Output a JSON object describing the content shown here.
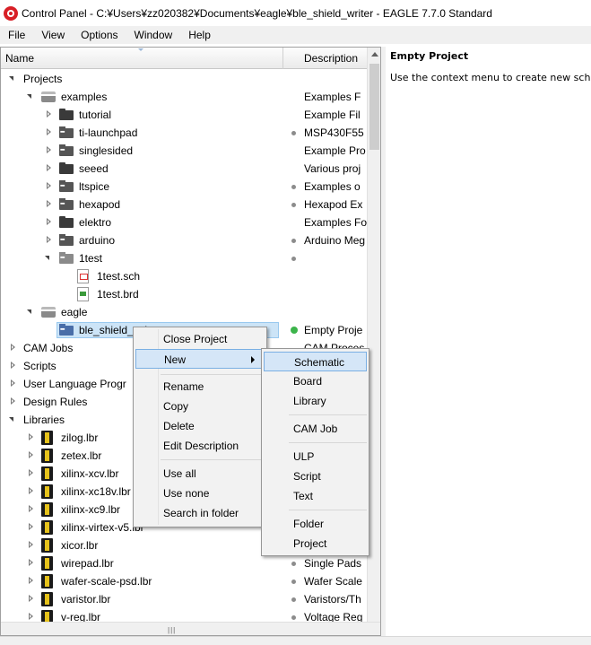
{
  "window": {
    "title": "Control Panel - C:¥Users¥zz020382¥Documents¥eagle¥ble_shield_writer - EAGLE 7.7.0 Standard"
  },
  "menubar": {
    "items": [
      {
        "label": "File"
      },
      {
        "label": "View"
      },
      {
        "label": "Options"
      },
      {
        "label": "Window"
      },
      {
        "label": "Help"
      }
    ]
  },
  "tree": {
    "header": {
      "name": "Name",
      "description": "Description"
    },
    "rows": [
      {
        "label": "Projects",
        "desc": "",
        "icon": "none",
        "toggle": "expanded",
        "dot": ""
      },
      {
        "label": "examples",
        "desc": "Examples F",
        "icon": "projects-folder-icon",
        "toggle": "expanded",
        "dot": ""
      },
      {
        "label": "tutorial",
        "desc": "Example Fil",
        "icon": "folder-icon",
        "toggle": "collapsed",
        "dot": ""
      },
      {
        "label": "ti-launchpad",
        "desc": "MSP430F55",
        "icon": "project-icon",
        "toggle": "collapsed",
        "dot": "gray"
      },
      {
        "label": "singlesided",
        "desc": "Example Pro",
        "icon": "project-icon",
        "toggle": "collapsed",
        "dot": ""
      },
      {
        "label": "seeed",
        "desc": "Various proj",
        "icon": "folder-icon",
        "toggle": "collapsed",
        "dot": ""
      },
      {
        "label": "ltspice",
        "desc": "Examples o",
        "icon": "project-icon",
        "toggle": "collapsed",
        "dot": "gray"
      },
      {
        "label": "hexapod",
        "desc": "Hexapod Ex",
        "icon": "project-icon",
        "toggle": "collapsed",
        "dot": "gray"
      },
      {
        "label": "elektro",
        "desc": "Examples Fo",
        "icon": "folder-icon",
        "toggle": "collapsed",
        "dot": ""
      },
      {
        "label": "arduino",
        "desc": "Arduino Meg",
        "icon": "project-icon",
        "toggle": "collapsed",
        "dot": "gray"
      },
      {
        "label": "1test",
        "desc": "",
        "icon": "project-icon-light",
        "toggle": "expanded",
        "dot": "gray"
      },
      {
        "label": "1test.sch",
        "desc": "",
        "icon": "schematic-file-icon",
        "toggle": "none",
        "dot": ""
      },
      {
        "label": "1test.brd",
        "desc": "",
        "icon": "board-file-icon",
        "toggle": "none",
        "dot": ""
      },
      {
        "label": "eagle",
        "desc": "",
        "icon": "projects-folder-icon",
        "toggle": "expanded",
        "dot": ""
      },
      {
        "label": "ble_shield_writer",
        "desc": "Empty Proje",
        "icon": "project-icon-blue",
        "toggle": "none",
        "dot": "green"
      },
      {
        "label": "CAM Jobs",
        "desc": "CAM Proces",
        "icon": "none",
        "toggle": "collapsed",
        "dot": ""
      },
      {
        "label": "Scripts",
        "desc": "",
        "icon": "none",
        "toggle": "collapsed",
        "dot": ""
      },
      {
        "label": "User Language Progr",
        "desc": "",
        "icon": "none",
        "toggle": "collapsed",
        "dot": ""
      },
      {
        "label": "Design Rules",
        "desc": "",
        "icon": "none",
        "toggle": "collapsed",
        "dot": ""
      },
      {
        "label": "Libraries",
        "desc": "",
        "icon": "none",
        "toggle": "expanded",
        "dot": ""
      },
      {
        "label": "zilog.lbr",
        "desc": "",
        "icon": "library-icon",
        "toggle": "collapsed",
        "dot": ""
      },
      {
        "label": "zetex.lbr",
        "desc": "",
        "icon": "library-icon",
        "toggle": "collapsed",
        "dot": ""
      },
      {
        "label": "xilinx-xcv.lbr",
        "desc": "",
        "icon": "library-icon",
        "toggle": "collapsed",
        "dot": ""
      },
      {
        "label": "xilinx-xc18v.lbr",
        "desc": "",
        "icon": "library-icon",
        "toggle": "collapsed",
        "dot": ""
      },
      {
        "label": "xilinx-xc9.lbr",
        "desc": "",
        "icon": "library-icon",
        "toggle": "collapsed",
        "dot": ""
      },
      {
        "label": "xilinx-virtex-v5.lbr",
        "desc": "",
        "icon": "library-icon",
        "toggle": "collapsed",
        "dot": ""
      },
      {
        "label": "xicor.lbr",
        "desc": "",
        "icon": "library-icon",
        "toggle": "collapsed",
        "dot": ""
      },
      {
        "label": "wirepad.lbr",
        "desc": "Single Pads",
        "icon": "library-icon",
        "toggle": "collapsed",
        "dot": "gray"
      },
      {
        "label": "wafer-scale-psd.lbr",
        "desc": "Wafer Scale",
        "icon": "library-icon",
        "toggle": "collapsed",
        "dot": "gray"
      },
      {
        "label": "varistor.lbr",
        "desc": "Varistors/Th",
        "icon": "library-icon",
        "toggle": "collapsed",
        "dot": "gray"
      },
      {
        "label": "v-reg.lbr",
        "desc": "Voltage Reg",
        "icon": "library-icon",
        "toggle": "collapsed",
        "dot": "gray"
      }
    ]
  },
  "description_pane": {
    "title": "Empty Project",
    "text": "Use the context menu to create new schem"
  },
  "context_menu": {
    "items": [
      "Close Project",
      "New",
      "Rename",
      "Copy",
      "Delete",
      "Edit Description",
      "Use all",
      "Use none",
      "Search in folder"
    ]
  },
  "new_submenu": {
    "items": [
      "Schematic",
      "Board",
      "Library",
      "CAM Job",
      "ULP",
      "Script",
      "Text",
      "Folder",
      "Project"
    ]
  },
  "colors": {
    "selection": "#cce4f7",
    "menu_highlight": "#d5e6f7",
    "active_dot": "#3cb44b"
  }
}
